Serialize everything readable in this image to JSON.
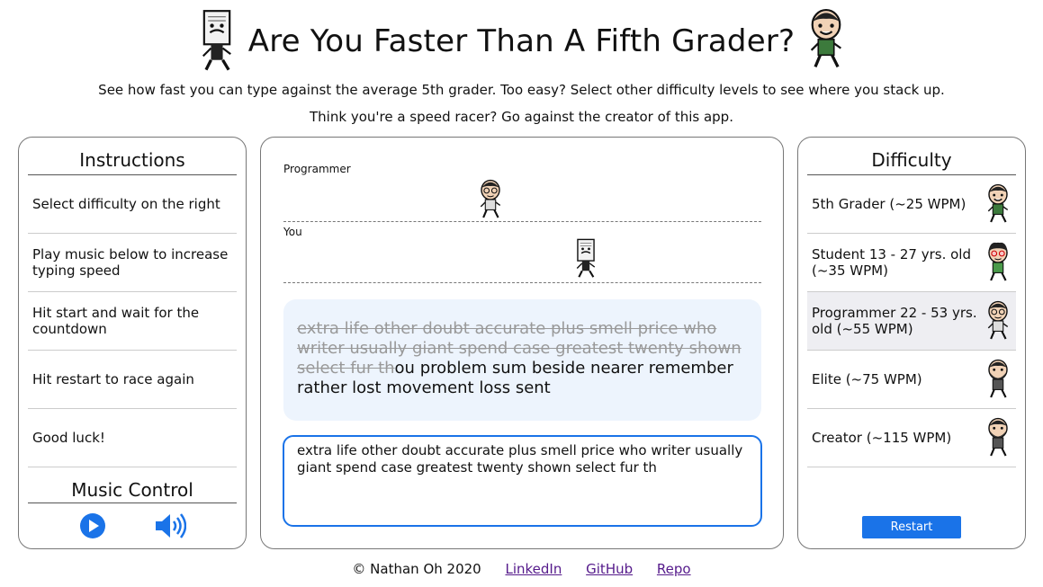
{
  "header": {
    "title": "Are You Faster Than A Fifth Grader?",
    "subtitle1": "See how fast you can type against the average 5th grader. Too easy? Select other difficulty levels to see where you stack up.",
    "subtitle2": "Think you're a speed racer? Go against the creator of this app."
  },
  "instructions": {
    "title": "Instructions",
    "items": [
      "Select difficulty on the right",
      "Play music below to increase typing speed",
      "Hit start and wait for the countdown",
      "Hit restart to race again",
      "Good luck!"
    ]
  },
  "music": {
    "title": "Music Control",
    "play_icon": "play-circle-icon",
    "volume_icon": "volume-up-icon"
  },
  "race": {
    "opponent_label": "Programmer",
    "you_label": "You",
    "opponent_progress": 0.43,
    "you_progress": 0.64,
    "typed_text": "extra life other doubt accurate plus smell price who writer usually giant spend case greatest twenty shown select fur th",
    "remaining_text": "ou problem sum beside nearer remember rather lost movement loss sent",
    "input_value": "extra life other doubt accurate plus smell price who writer usually giant spend case greatest twenty shown select fur th"
  },
  "difficulty": {
    "title": "Difficulty",
    "selected_index": 2,
    "items": [
      "5th Grader (~25 WPM)",
      "Student 13 - 27 yrs. old (~35 WPM)",
      "Programmer 22 - 53 yrs. old (~55 WPM)",
      "Elite (~75 WPM)",
      "Creator (~115 WPM)"
    ],
    "restart_label": "Restart"
  },
  "footer": {
    "copyright": "© Nathan Oh 2020",
    "links": [
      "LinkedIn",
      "GitHub",
      "Repo"
    ]
  },
  "colors": {
    "accent": "#1a73e8",
    "text_box_bg": "#edf4fd",
    "selected_bg": "#eeeef2",
    "link": "#551a8b"
  }
}
